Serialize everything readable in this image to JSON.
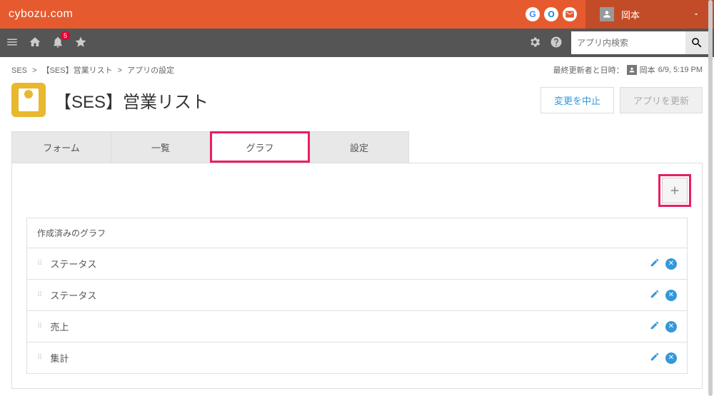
{
  "header": {
    "brand": "cybozu.com",
    "user_name": "岡本"
  },
  "subheader": {
    "notification_count": "5",
    "search_placeholder": "アプリ内検索"
  },
  "breadcrumb": {
    "items": [
      "SES",
      "【SES】営業リスト",
      "アプリの設定"
    ]
  },
  "update_info": {
    "label": "最終更新者と日時：",
    "user": "岡本",
    "datetime": "6/9, 5:19 PM"
  },
  "app": {
    "title": "【SES】営業リスト"
  },
  "actions": {
    "cancel": "変更を中止",
    "update": "アプリを更新"
  },
  "tabs": {
    "form": "フォーム",
    "list": "一覧",
    "graph": "グラフ",
    "settings": "設定"
  },
  "graph_section": {
    "header": "作成済みのグラフ",
    "items": [
      {
        "name": "ステータス"
      },
      {
        "name": "ステータス"
      },
      {
        "name": "売上"
      },
      {
        "name": "集計"
      }
    ]
  }
}
